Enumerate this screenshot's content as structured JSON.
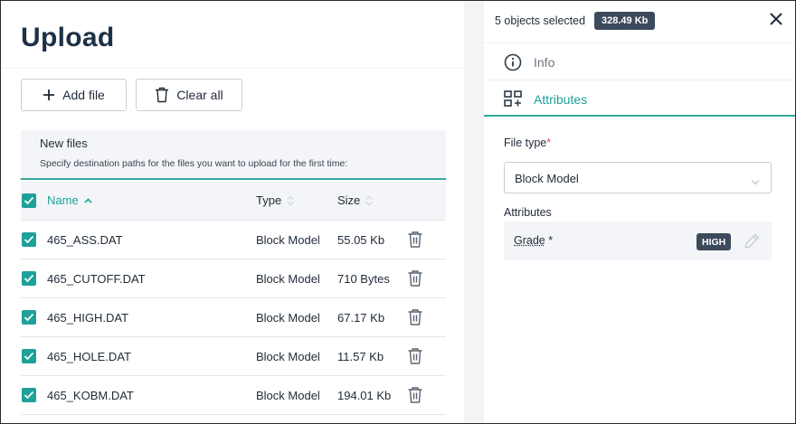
{
  "upload": {
    "title": "Upload",
    "add_file_label": "Add file",
    "clear_all_label": "Clear all",
    "new_files": {
      "heading": "New files",
      "subtitle": "Specify destination paths for the files you want to upload for the first time:"
    },
    "columns": {
      "name": "Name",
      "type": "Type",
      "size": "Size"
    },
    "files": [
      {
        "name": "465_ASS.DAT",
        "type": "Block Model",
        "size": "55.05 Kb",
        "checked": true
      },
      {
        "name": "465_CUTOFF.DAT",
        "type": "Block Model",
        "size": "710 Bytes",
        "checked": true
      },
      {
        "name": "465_HIGH.DAT",
        "type": "Block Model",
        "size": "67.17 Kb",
        "checked": true
      },
      {
        "name": "465_HOLE.DAT",
        "type": "Block Model",
        "size": "11.57 Kb",
        "checked": true
      },
      {
        "name": "465_KOBM.DAT",
        "type": "Block Model",
        "size": "194.01 Kb",
        "checked": true
      }
    ]
  },
  "details": {
    "selection_text": "5 objects selected",
    "selection_size": "328.49 Kb",
    "tabs": [
      {
        "label": "Info",
        "icon": "info-icon",
        "active": false
      },
      {
        "label": "Attributes",
        "icon": "attributes-icon",
        "active": true
      }
    ],
    "file_type_label": "File type",
    "required_mark": "*",
    "file_type_value": "Block Model",
    "attributes_label": "Attributes",
    "attributes": [
      {
        "name": "Grade",
        "required_mark": "*",
        "value": "HIGH"
      }
    ]
  },
  "colors": {
    "accent": "#1ea19a",
    "badge": "#3c4a5c",
    "title": "#1d3146",
    "required": "#d9534f"
  }
}
